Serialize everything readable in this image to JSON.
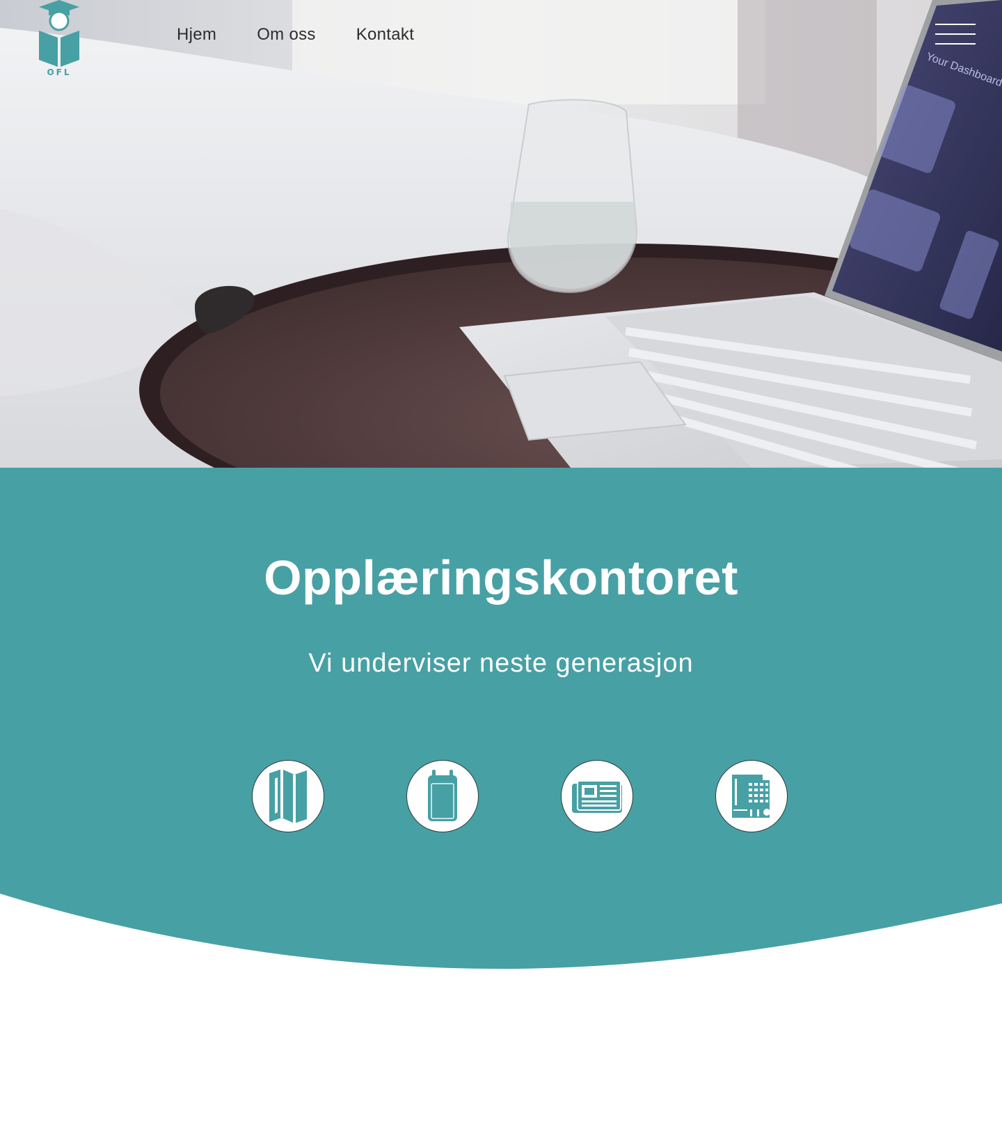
{
  "nav": {
    "logo_text": "OFL",
    "links": [
      {
        "label": "Hjem"
      },
      {
        "label": "Om oss"
      },
      {
        "label": "Kontakt"
      }
    ],
    "menu_icon": "hamburger-icon"
  },
  "hero": {
    "laptop_screen_text": "Your Dashboard"
  },
  "main": {
    "title": "Opplæringskontoret",
    "subtitle": "Vi underviser neste generasjon",
    "icons": [
      {
        "name": "map-icon"
      },
      {
        "name": "calendar-icon"
      },
      {
        "name": "newspaper-icon"
      },
      {
        "name": "building-icon"
      }
    ]
  },
  "colors": {
    "teal": "#47a0a4",
    "nav_text": "#2e2b2c",
    "white": "#ffffff"
  }
}
